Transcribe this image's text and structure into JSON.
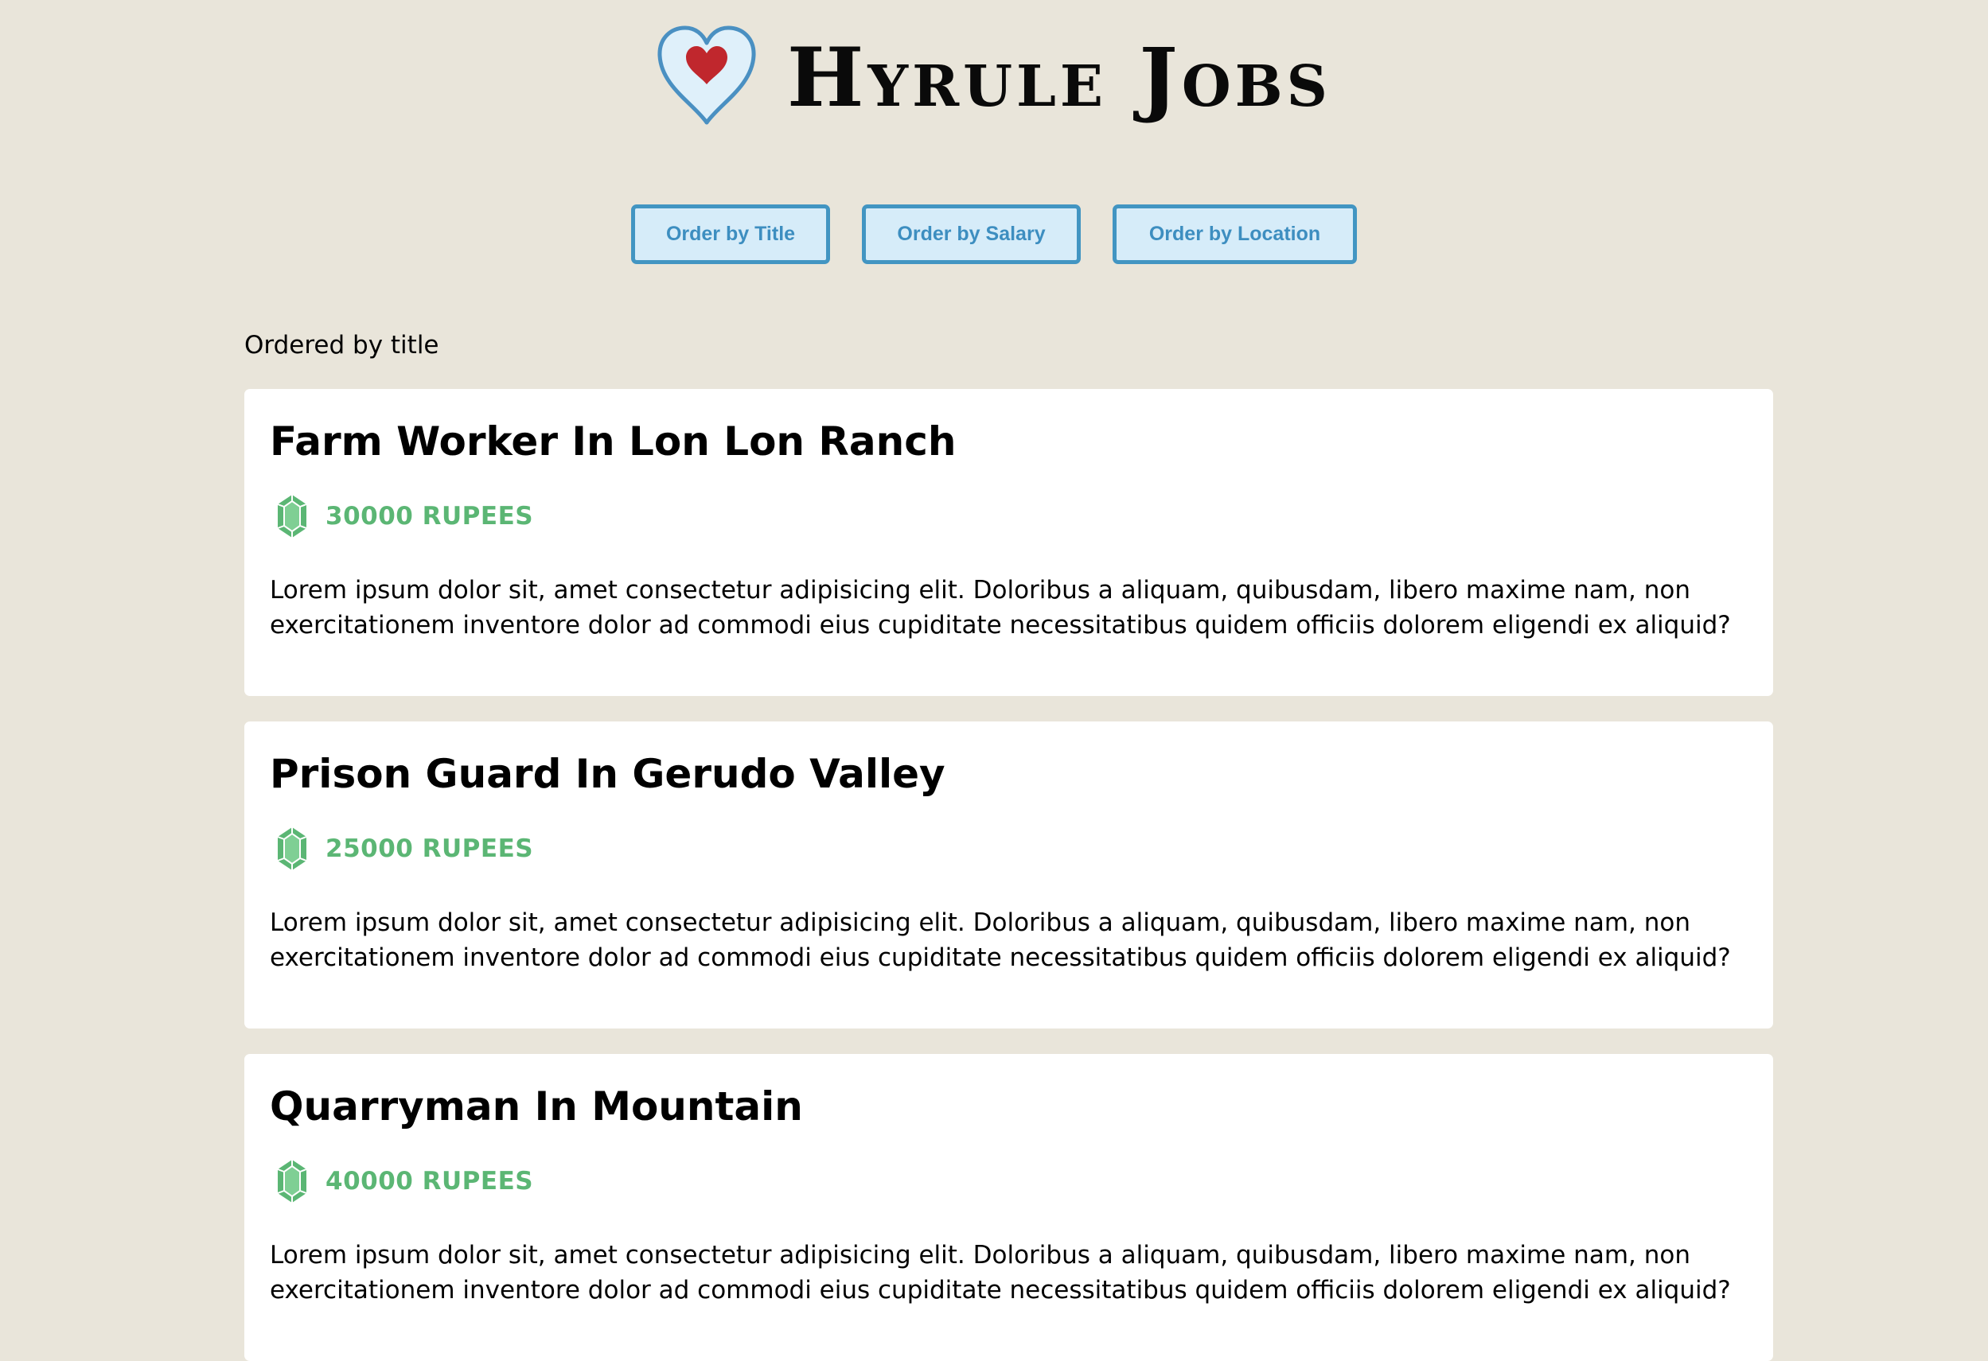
{
  "brand": {
    "title": "Hyrule Jobs",
    "heart_outline_color": "#4a90c2",
    "heart_fill_color": "#dff0fa",
    "heart_inner_color": "#c0272d"
  },
  "sort_buttons": {
    "title": "Order by Title",
    "salary": "Order by Salary",
    "location": "Order by Location"
  },
  "ordered_label": "Ordered by title",
  "colors": {
    "background": "#e9e5da",
    "button_border": "#4295c2",
    "button_fill": "#d6ecf9",
    "salary_green": "#5bb674"
  },
  "jobs": [
    {
      "title": "Farm Worker In Lon Lon Ranch",
      "salary": "30000 RUPEES",
      "icon": "rupee-icon",
      "description": "Lorem ipsum dolor sit, amet consectetur adipisicing elit. Doloribus a aliquam, quibusdam, libero maxime nam, non exercitationem inventore dolor ad commodi eius cupiditate necessitatibus quidem officiis dolorem eligendi ex aliquid?"
    },
    {
      "title": "Prison Guard In Gerudo Valley",
      "salary": "25000 RUPEES",
      "icon": "rupee-icon",
      "description": "Lorem ipsum dolor sit, amet consectetur adipisicing elit. Doloribus a aliquam, quibusdam, libero maxime nam, non exercitationem inventore dolor ad commodi eius cupiditate necessitatibus quidem officiis dolorem eligendi ex aliquid?"
    },
    {
      "title": "Quarryman In Mountain",
      "salary": "40000 RUPEES",
      "icon": "rupee-icon",
      "description": "Lorem ipsum dolor sit, amet consectetur adipisicing elit. Doloribus a aliquam, quibusdam, libero maxime nam, non exercitationem inventore dolor ad commodi eius cupiditate necessitatibus quidem officiis dolorem eligendi ex aliquid?"
    }
  ]
}
